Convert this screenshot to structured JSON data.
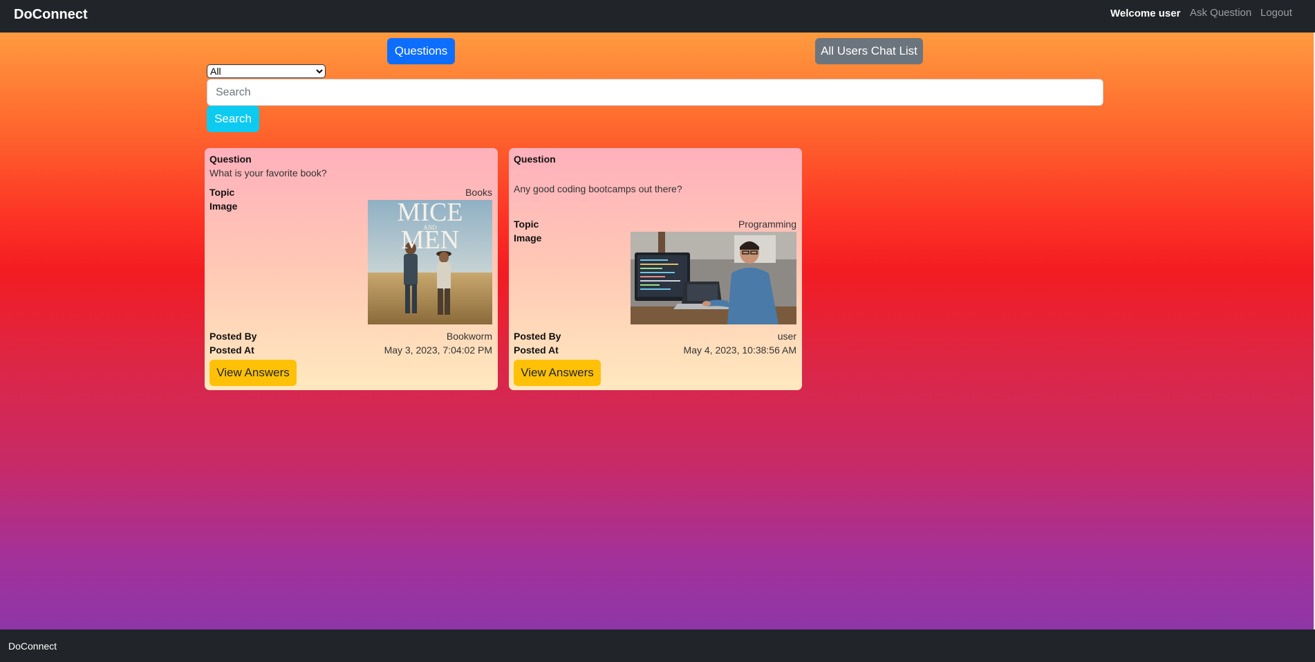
{
  "navbar": {
    "brand": "DoConnect",
    "welcome": "Welcome user",
    "ask_question": "Ask Question",
    "logout": "Logout"
  },
  "main": {
    "questions_button": "Questions",
    "chat_button": "All Users Chat List",
    "filter": {
      "selected": "All"
    },
    "search": {
      "placeholder": "Search",
      "value": "",
      "button": "Search"
    }
  },
  "cards": [
    {
      "question_label": "Question",
      "question": "What is your favorite book?",
      "topic_label": "Topic",
      "topic": "Books",
      "image_label": "Image",
      "image_text_top": "MICE",
      "image_text_mid": "AND",
      "image_text_bottom": "MEN",
      "posted_by_label": "Posted By",
      "posted_by": "Bookworm",
      "posted_at_label": "Posted At",
      "posted_at": "May 3, 2023, 7:04:02 PM",
      "button": "View Answers"
    },
    {
      "question_label": "Question",
      "question": "Any good coding bootcamps out there?",
      "topic_label": "Topic",
      "topic": "Programming",
      "image_label": "Image",
      "posted_by_label": "Posted By",
      "posted_by": "user",
      "posted_at_label": "Posted At",
      "posted_at": "May 4, 2023, 10:38:56 AM",
      "button": "View Answers"
    }
  ],
  "footer": {
    "brand": "DoConnect"
  },
  "colors": {
    "navbar": "#212529",
    "primary": "#0d6efd",
    "secondary": "#6c757d",
    "info": "#0dcaf0",
    "warning": "#ffc107"
  }
}
